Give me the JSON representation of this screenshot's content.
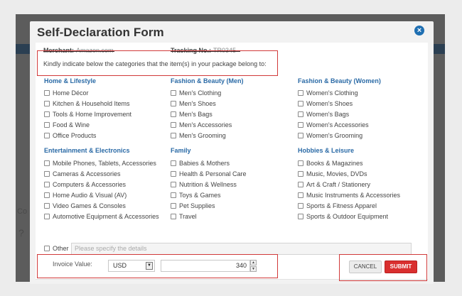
{
  "modal": {
    "title": "Self-Declaration Form",
    "close_glyph": "×"
  },
  "meta": {
    "merchant_label": "Merchant:",
    "merchant_value": "Amazon.com",
    "tracking_label": "Tracking No.:",
    "tracking_value": "TR0345"
  },
  "instruction": "Kindly indicate below the categories that the item(s) in your package belong to:",
  "categories": [
    {
      "title": "Home & Lifestyle",
      "items": [
        "Home Décor",
        "Kitchen & Household Items",
        "Tools & Home Improvement",
        "Food & Wine",
        "Office Products"
      ]
    },
    {
      "title": "Fashion & Beauty (Men)",
      "items": [
        "Men's Clothing",
        "Men's Shoes",
        "Men's Bags",
        "Men's Accessories",
        "Men's Grooming"
      ]
    },
    {
      "title": "Fashion & Beauty (Women)",
      "items": [
        "Women's Clothing",
        "Women's Shoes",
        "Women's Bags",
        "Women's Accessories",
        "Women's Grooming"
      ]
    },
    {
      "title": "Entertainment & Electronics",
      "items": [
        "Mobile Phones, Tablets, Accessories",
        "Cameras & Accessories",
        "Computers & Accessories",
        "Home Audio & Visual (AV)",
        "Video Games & Consoles",
        "Automotive Equipment & Accessories"
      ]
    },
    {
      "title": "Family",
      "items": [
        "Babies & Mothers",
        "Health & Personal Care",
        "Nutrition & Wellness",
        "Toys & Games",
        "Pet Supplies",
        "Travel"
      ]
    },
    {
      "title": "Hobbies & Leisure",
      "items": [
        "Books & Magazines",
        "Music, Movies, DVDs",
        "Art & Craft / Stationery",
        "Music Instruments & Accessories",
        "Sports & Fitness Apparel",
        "Sports & Outdoor Equipment"
      ]
    }
  ],
  "other": {
    "label": "Other",
    "placeholder": "Please specify the details"
  },
  "invoice": {
    "label": "Invoice Value:",
    "currency": "USD",
    "amount": "340"
  },
  "buttons": {
    "cancel": "CANCEL",
    "submit": "SUBMIT"
  },
  "background": {
    "frag_1": "Co",
    "frag_2": "?"
  },
  "colors": {
    "accent": "#2a6aa6",
    "submit": "#d92f2f",
    "highlight_box": "#d13a3a"
  }
}
